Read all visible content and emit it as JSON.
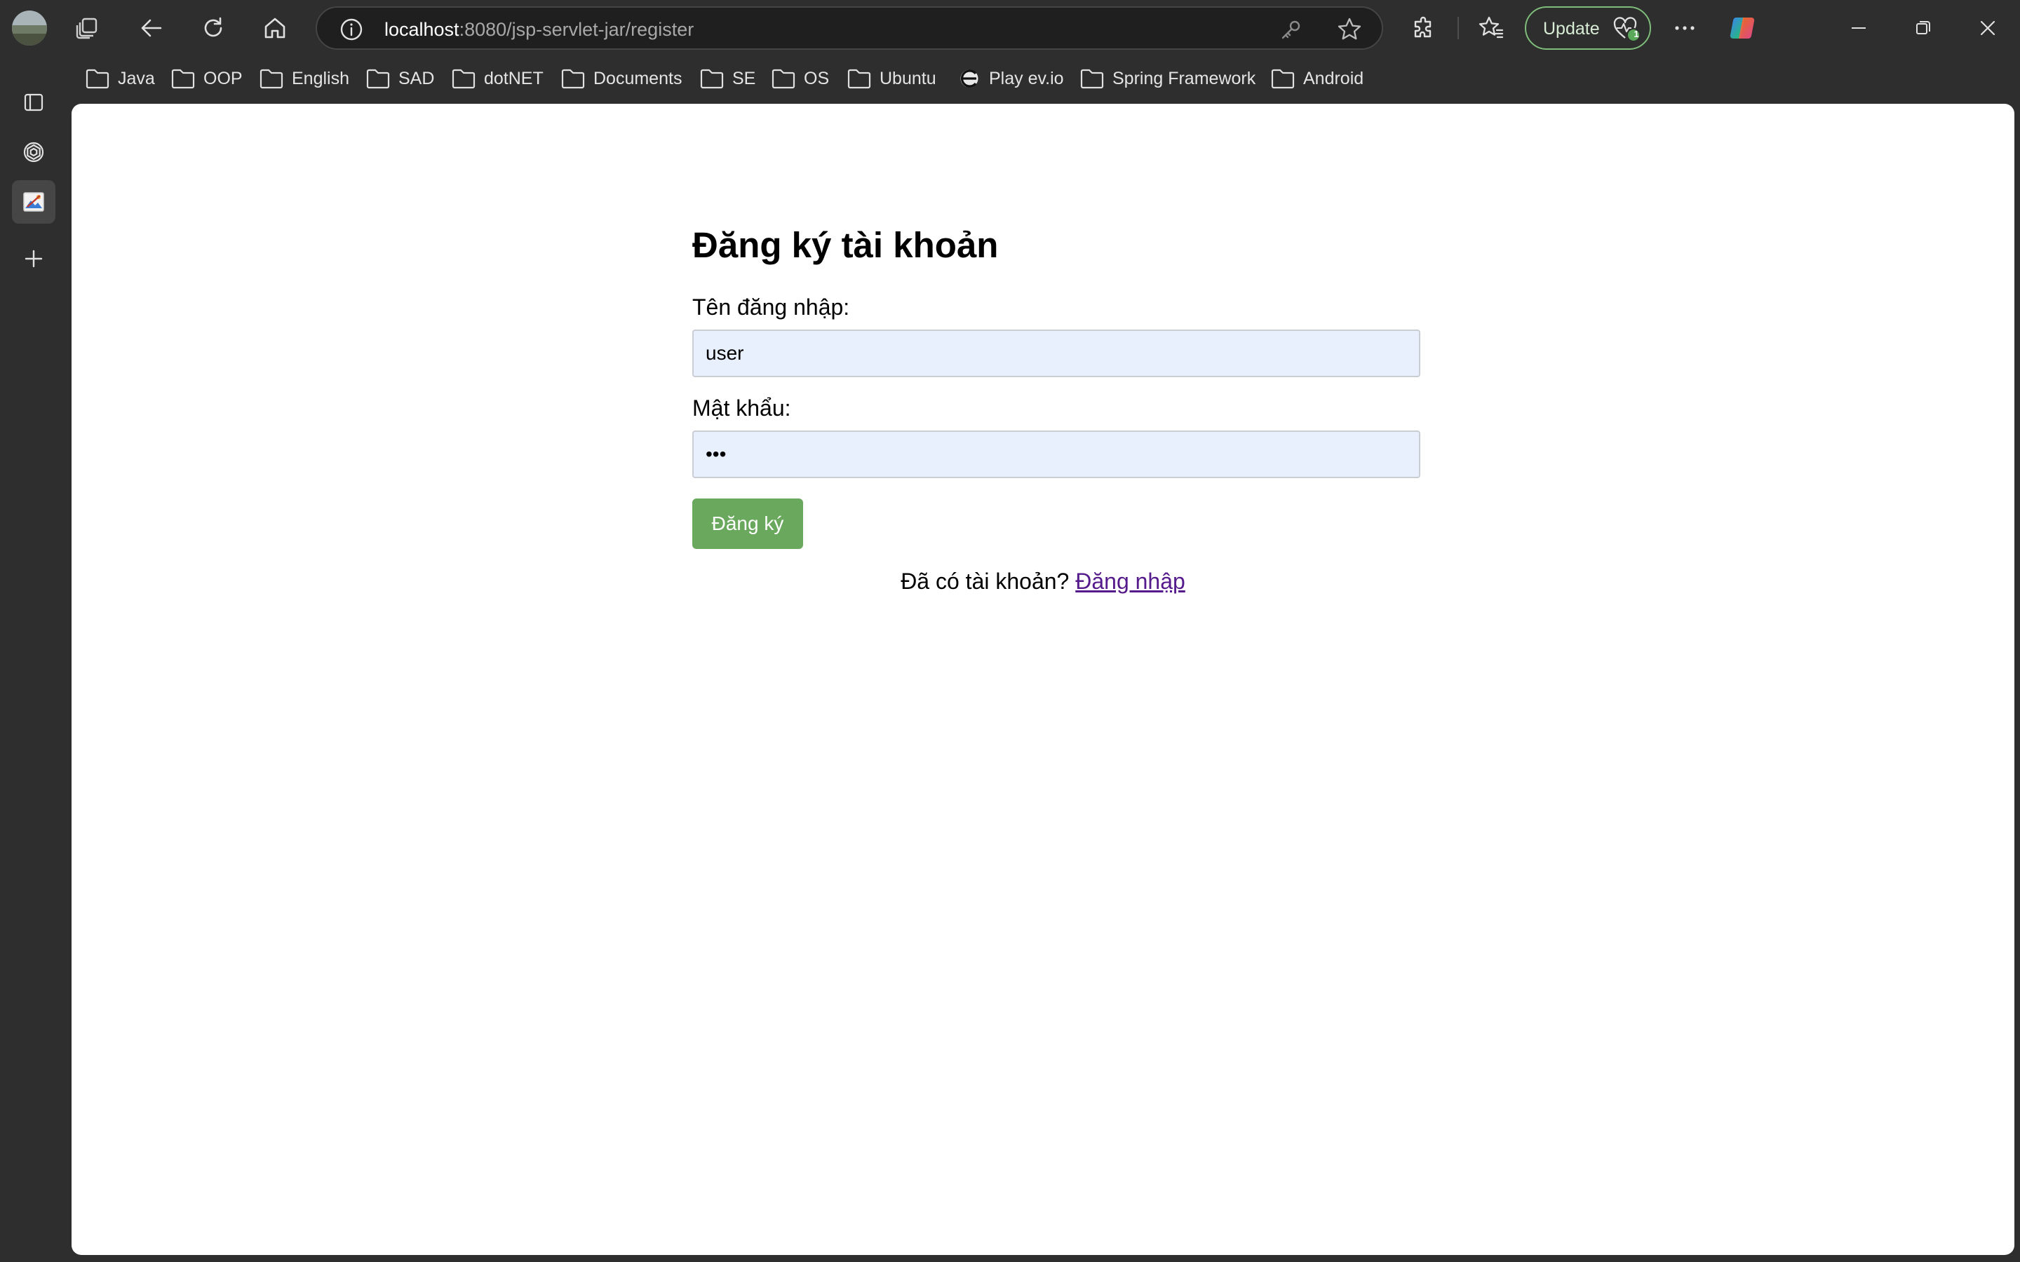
{
  "browser": {
    "url_host": "localhost",
    "url_path": ":8080/jsp-servlet-jar/register",
    "update_label": "Update",
    "update_badge": "1",
    "colors": {
      "chrome": "#2e2e2e",
      "address_bar": "#1f1f1f",
      "update_border": "#7dbd79"
    }
  },
  "bookmarks": [
    {
      "label": "Java",
      "icon": "folder-icon"
    },
    {
      "label": "OOP",
      "icon": "folder-icon"
    },
    {
      "label": "English",
      "icon": "folder-icon"
    },
    {
      "label": "SAD",
      "icon": "folder-icon"
    },
    {
      "label": "dotNET",
      "icon": "folder-icon"
    },
    {
      "label": "Documents",
      "icon": "folder-icon"
    },
    {
      "label": "SE",
      "icon": "folder-icon"
    },
    {
      "label": "OS",
      "icon": "folder-icon"
    },
    {
      "label": "Ubuntu",
      "icon": "folder-icon"
    },
    {
      "label": "Play ev.io",
      "icon": "ev-io-logo-icon"
    },
    {
      "label": "Spring Framework",
      "icon": "folder-icon"
    },
    {
      "label": "Android",
      "icon": "folder-icon"
    }
  ],
  "sidebar": {
    "items": [
      "tab-actions-icon",
      "chatgpt-icon",
      "image-tool-icon",
      "add-icon"
    ]
  },
  "page": {
    "title": "Đăng ký tài khoản",
    "username_label": "Tên đăng nhập:",
    "username_value": "user",
    "password_label": "Mật khẩu:",
    "password_value": "•••",
    "submit_label": "Đăng ký",
    "login_prompt": "Đã có tài khoản?",
    "login_link": "Đăng nhập",
    "colors": {
      "input_bg": "#e8f0fe",
      "button_bg": "#6aa85e",
      "link": "#551a8b"
    }
  }
}
